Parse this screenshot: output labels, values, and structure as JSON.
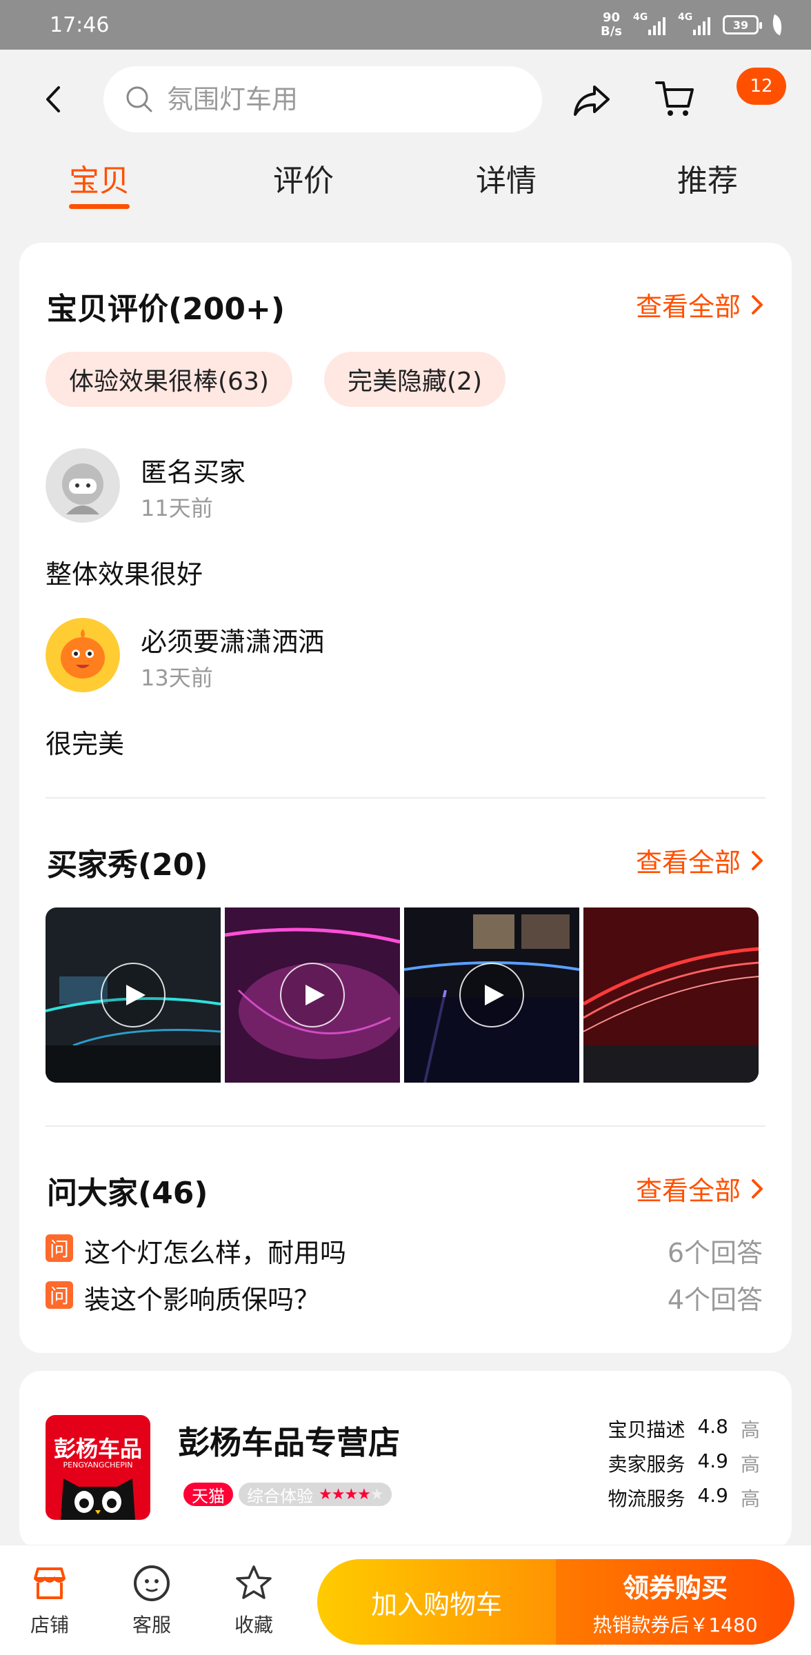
{
  "status_bar": {
    "time": "17:46",
    "net_speed_value": "90",
    "net_speed_unit": "B/s",
    "signal_1": "4G",
    "signal_2": "4G",
    "battery": "39"
  },
  "header": {
    "search_placeholder": "氛围灯车用",
    "message_badge": "12"
  },
  "tabs": [
    {
      "label": "宝贝",
      "active": true
    },
    {
      "label": "评价",
      "active": false
    },
    {
      "label": "详情",
      "active": false
    },
    {
      "label": "推荐",
      "active": false
    }
  ],
  "reviews_section": {
    "title": "宝贝评价(200+)",
    "see_all": "查看全部",
    "tags": [
      "体验效果很棒(63)",
      "完美隐藏(2)"
    ],
    "items": [
      {
        "user": "匿名买家",
        "time": "11天前",
        "text": "整体效果很好"
      },
      {
        "user": "必须要潇潇洒洒",
        "time": "13天前",
        "text": "很完美"
      }
    ]
  },
  "buyer_show": {
    "title": "买家秀(20)",
    "see_all": "查看全部"
  },
  "qa": {
    "title": "问大家(46)",
    "see_all": "查看全部",
    "icon_label": "问",
    "items": [
      {
        "question": "这个灯怎么样，耐用吗",
        "answers": "6个回答"
      },
      {
        "question": "装这个影响质保吗？",
        "answers": "4个回答"
      }
    ]
  },
  "store": {
    "logo_text": "彭杨车品",
    "logo_sub": "PENGYANGCHEPIN",
    "name": "彭杨车品专营店",
    "tmall_badge": "天猫",
    "experience_label": "综合体验",
    "experience_stars": 4,
    "ratings": [
      {
        "label": "宝贝描述",
        "score": "4.8",
        "level": "高"
      },
      {
        "label": "卖家服务",
        "score": "4.9",
        "level": "高"
      },
      {
        "label": "物流服务",
        "score": "4.9",
        "level": "高"
      }
    ]
  },
  "bottom_bar": {
    "shop": "店铺",
    "service": "客服",
    "favorite": "收藏",
    "add_to_cart": "加入购物车",
    "buy_title": "领券购买",
    "buy_sub": "热销款券后￥1480"
  },
  "colors": {
    "accent": "#ff5000",
    "tag_bg": "#ffe7e2",
    "tmall": "#ff0036"
  }
}
